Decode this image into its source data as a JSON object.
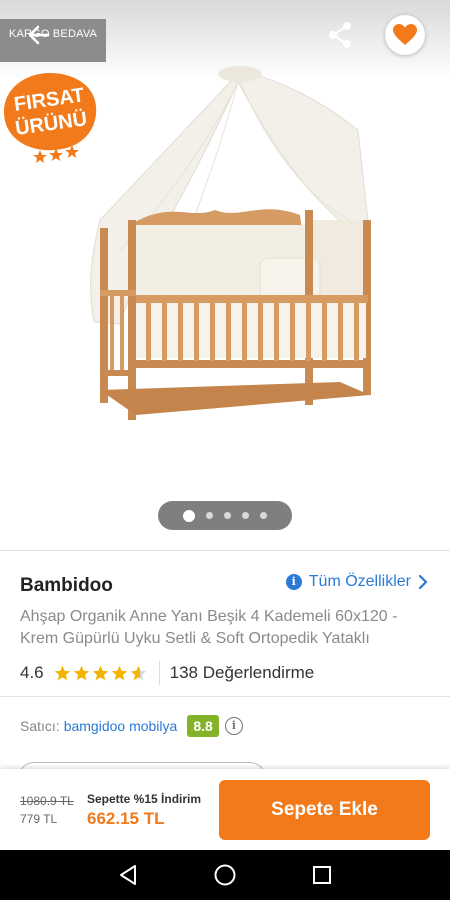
{
  "gallery": {
    "cargo_badge": "KARGO BEDAVA",
    "firsat_line1": "FIRSAT",
    "firsat_line2": "ÜRÜNÜ",
    "slide_count": 5,
    "active_slide": 1
  },
  "product": {
    "brand": "Bambidoo",
    "all_specs_label": "Tüm Özellikler",
    "title": "Ahşap Organik  Anne Yanı Beşik 4 Kademeli 60x120 - Krem Güpürlü Uyku Setli & Soft Ortopedik Yataklı",
    "rating_value": "4.6",
    "rating_stars": 4.6,
    "rating_count": "138 Değerlendirme"
  },
  "seller": {
    "label": "Satıcı:",
    "name": "bamgidoo mobilya",
    "score": "8.8"
  },
  "cart": {
    "old_price": "1080.9 TL",
    "list_price": "779 TL",
    "promo_label": "Sepette %15 İndirim",
    "promo_price": "662.15 TL",
    "add_button": "Sepete Ekle"
  },
  "colors": {
    "accent": "#f27a1a",
    "link": "#2a7ad6",
    "seller_score": "#84b32a",
    "star": "#f5b301"
  }
}
